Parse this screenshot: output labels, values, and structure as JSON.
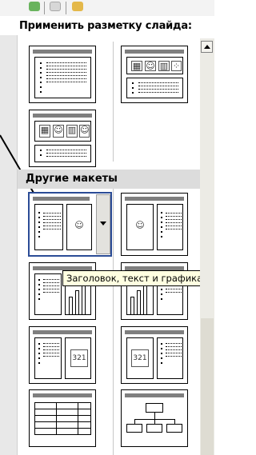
{
  "tabs": {
    "icons": [
      "green-tab-icon",
      "gray-tab-icon",
      "yellow-tab-icon"
    ]
  },
  "panel": {
    "heading": "Применить разметку слайда:",
    "section_other": "Другие макеты",
    "tooltip": "Заголовок, текст и графика"
  },
  "layouts": {
    "top": [
      "Заголовок и текст",
      "Заголовок, графика и текст (2 столбца)",
      "Заголовок, графика и текст"
    ],
    "other": [
      "Текст и графика",
      "Графика и текст",
      "Текст и диаграмма",
      "Диаграмма и текст",
      "Текст и клип",
      "Клип и текст",
      "Таблица",
      "Организационная диаграмма"
    ]
  },
  "colors": {
    "selection": "#2b4c96",
    "tooltip_bg": "#ffffe1",
    "section_bg": "#dcdcdc"
  }
}
